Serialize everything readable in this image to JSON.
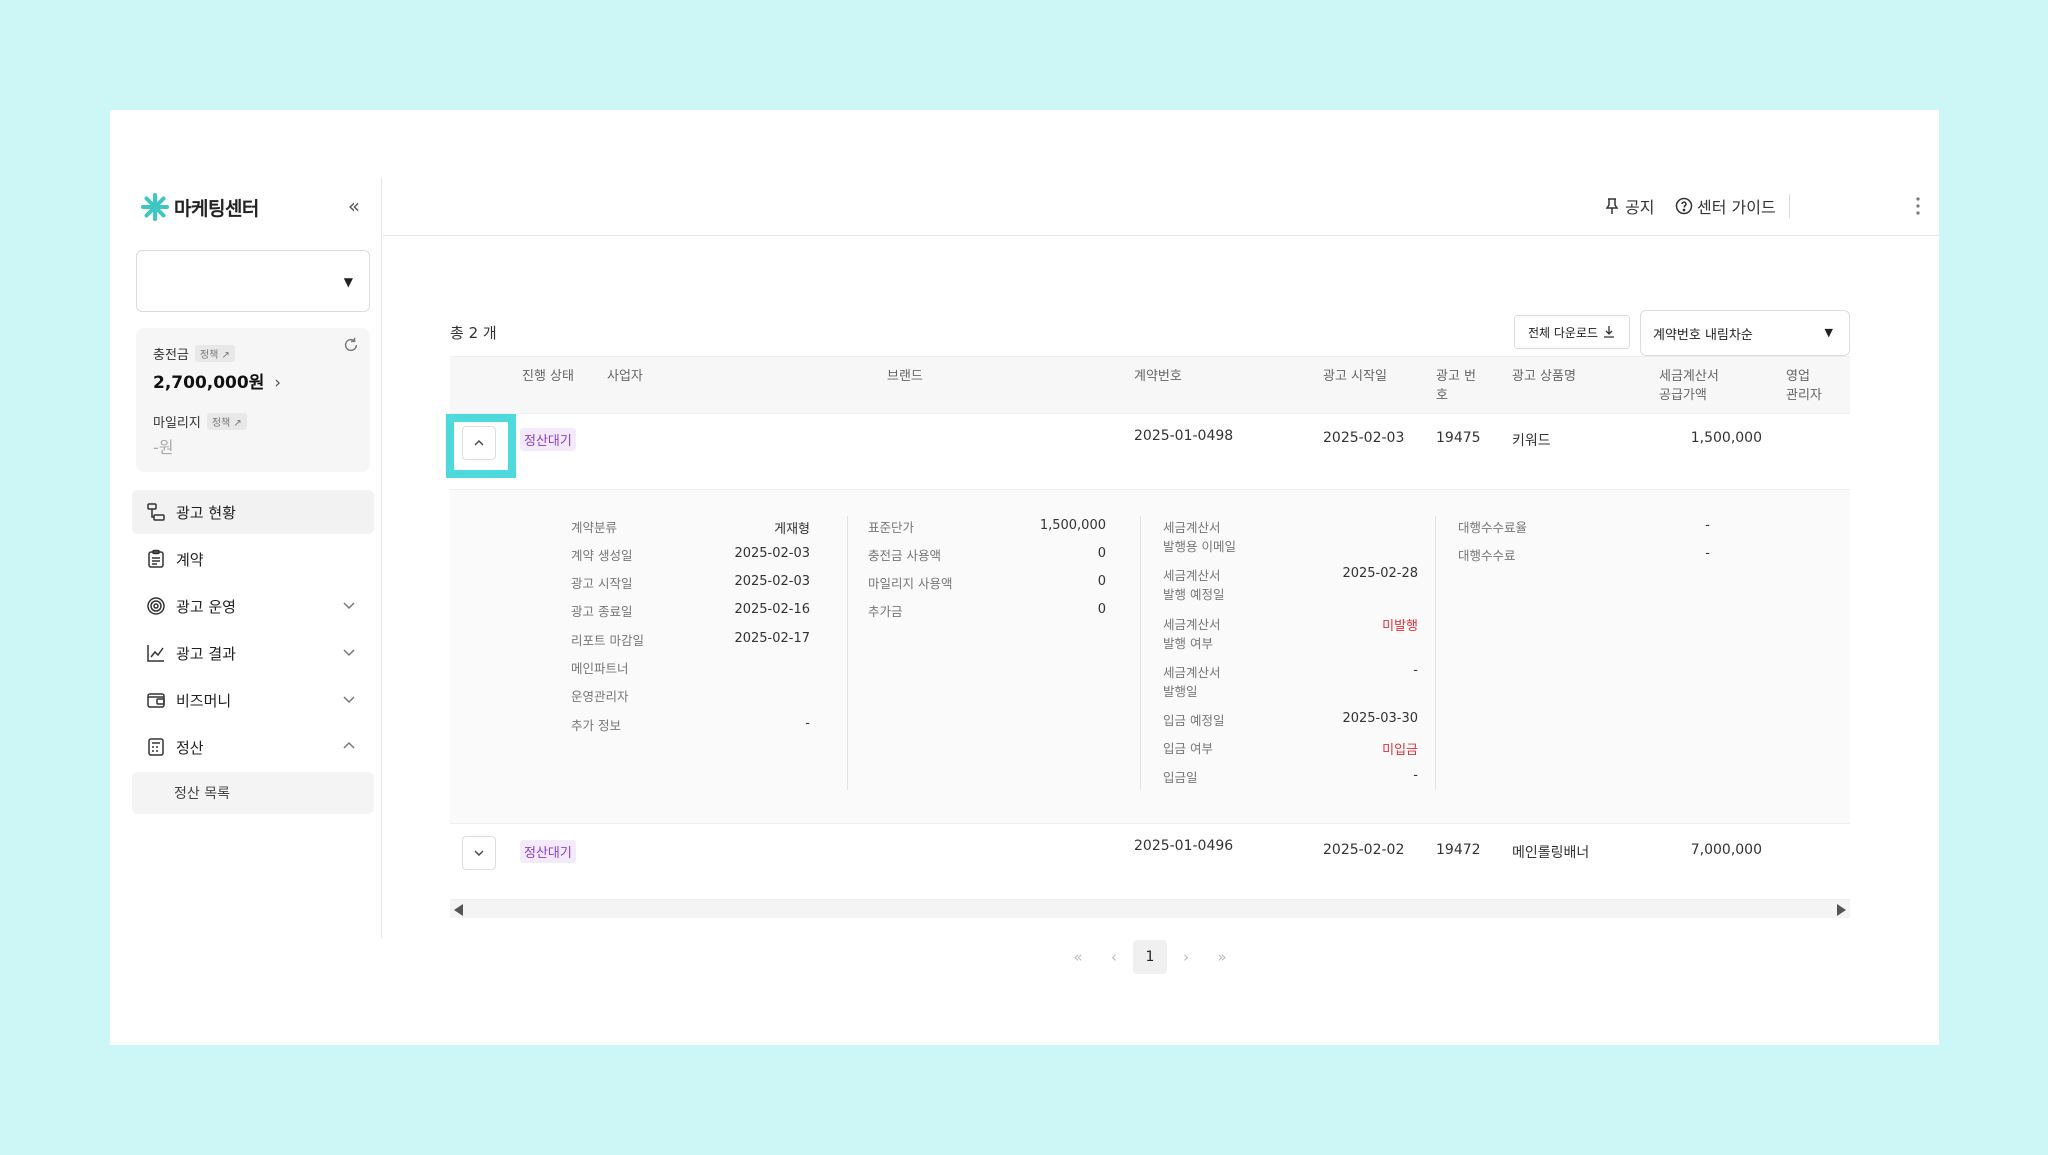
{
  "sidebar": {
    "brand": "마케팅센터",
    "collapse_icon": "double-chevron-left-icon",
    "account_selected": "",
    "balance": {
      "charge_label": "충전금",
      "charge_policy": "정책 ↗",
      "charge_value": "2,700,000원",
      "mileage_label": "마일리지",
      "mileage_policy": "정책 ↗",
      "mileage_value": "-원"
    },
    "nav": [
      {
        "label": "광고 현황",
        "icon": "flowchart-icon"
      },
      {
        "label": "계약",
        "icon": "clipboard-icon"
      },
      {
        "label": "광고 운영",
        "icon": "target-icon"
      },
      {
        "label": "광고 결과",
        "icon": "line-chart-icon"
      },
      {
        "label": "비즈머니",
        "icon": "wallet-icon"
      },
      {
        "label": "정산",
        "icon": "calculator-icon"
      }
    ],
    "sub_item": "정산 목록"
  },
  "topbar": {
    "notice": "공지",
    "guide": "센터 가이드"
  },
  "content": {
    "total": "총 2 개",
    "download": "전체 다운로드",
    "sort": "계약번호 내림차순",
    "headers": {
      "status": "진행 상태",
      "business": "사업자",
      "brand": "브랜드",
      "contract_no": "계약번호",
      "start": "광고 시작일",
      "ad_no_1": "광고 번",
      "ad_no_2": "호",
      "product": "광고 상품명",
      "tax_1": "세금계산서",
      "tax_2": "공급가액",
      "sales_1": "영업",
      "sales_2": "관리자"
    },
    "rows": [
      {
        "status": "정산대기",
        "contract_no": "2025-01-0498",
        "start": "2025-02-03",
        "ad_no": "19475",
        "product": "키워드",
        "amount": "1,500,000"
      },
      {
        "status": "정산대기",
        "contract_no": "2025-01-0496",
        "start": "2025-02-02",
        "ad_no": "19472",
        "product": "메인롤링배너",
        "amount": "7,000,000"
      }
    ],
    "detail": {
      "col1": [
        {
          "label": "계약분류",
          "value": "게재형"
        },
        {
          "label": "계약 생성일",
          "value": "2025-02-03"
        },
        {
          "label": "광고 시작일",
          "value": "2025-02-03"
        },
        {
          "label": "광고 종료일",
          "value": "2025-02-16"
        },
        {
          "label": "리포트 마감일",
          "value": "2025-02-17"
        },
        {
          "label": "메인파트너",
          "value": ""
        },
        {
          "label": "운영관리자",
          "value": ""
        },
        {
          "label": "추가 정보",
          "value": "-"
        }
      ],
      "col2": [
        {
          "label": "표준단가",
          "value": "1,500,000"
        },
        {
          "label": "충전금 사용액",
          "value": "0"
        },
        {
          "label": "마일리지 사용액",
          "value": "0"
        },
        {
          "label": "추가금",
          "value": "0"
        }
      ],
      "col3": [
        {
          "label1": "세금계산서",
          "label2": "발행용 이메일",
          "value": ""
        },
        {
          "label1": "세금계산서",
          "label2": "발행 예정일",
          "value": "2025-02-28"
        },
        {
          "label1": "세금계산서",
          "label2": "발행 여부",
          "value": "미발행"
        },
        {
          "label1": "세금계산서",
          "label2": "발행일",
          "value": "-"
        },
        {
          "label1": "입금 예정일",
          "label2": "",
          "value": "2025-03-30"
        },
        {
          "label1": "입금 여부",
          "label2": "",
          "value": "미입금"
        },
        {
          "label1": "입금일",
          "label2": "",
          "value": "-"
        }
      ],
      "col4": [
        {
          "label": "대행수수료율",
          "value": "-"
        },
        {
          "label": "대행수수료",
          "value": "-"
        }
      ]
    },
    "pager": {
      "first": "«",
      "prev": "‹",
      "page": "1",
      "next": "›",
      "last": "»"
    }
  },
  "colors": {
    "accent_status": "#8b3fd1",
    "alert_red": "#e0313a",
    "highlight": "#4ed9dc",
    "background": "#ccf7f6"
  }
}
